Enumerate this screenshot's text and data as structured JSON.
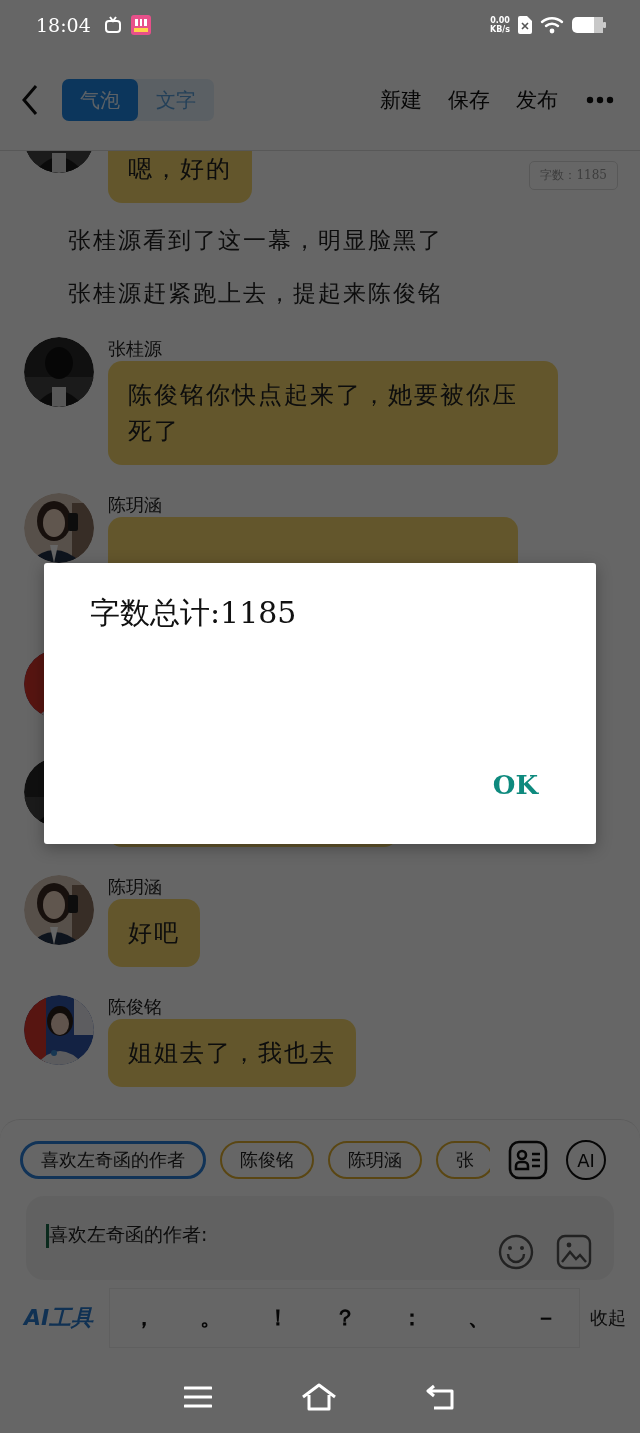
{
  "status_bar": {
    "time": "18:04",
    "net_speed": "0.00",
    "net_unit": "KB/s"
  },
  "header": {
    "tabs": [
      {
        "label": "气泡",
        "selected": true
      },
      {
        "label": "文字",
        "selected": false
      }
    ],
    "actions": [
      "新建",
      "保存",
      "发布"
    ]
  },
  "word_count_badge": "字数：1185",
  "messages": [
    {
      "kind": "bubble",
      "text": "嗯，好的"
    },
    {
      "kind": "narration",
      "text": "张桂源看到了这一幕，明显脸黑了"
    },
    {
      "kind": "narration",
      "text": "张桂源赶紧跑上去，提起来陈俊铭"
    },
    {
      "kind": "bubble",
      "name": "张桂源",
      "text": "陈俊铭你快点起来了，她要被你压死了"
    },
    {
      "kind": "partial",
      "name": "陈玥涵"
    },
    {
      "kind": "covered"
    },
    {
      "kind": "bubble"
    },
    {
      "kind": "bubble",
      "name": "陈玥涵",
      "text": "好吧"
    },
    {
      "kind": "bubble",
      "name": "陈俊铭",
      "text": "姐姐去了，我也去"
    }
  ],
  "chips": [
    {
      "label": "喜欢左奇函的作者",
      "selected": true
    },
    {
      "label": "陈俊铭",
      "selected": false
    },
    {
      "label": "陈玥涵",
      "selected": false
    },
    {
      "label": "张",
      "selected": false
    }
  ],
  "ai_button": "AI",
  "composer": {
    "value": "喜欢左奇函的作者:"
  },
  "toolbar": {
    "ai_tools": "AI工具",
    "punctuation": [
      "，",
      "。",
      "！",
      "？",
      "：",
      "、",
      "－"
    ],
    "collapse": "收起"
  },
  "dialog": {
    "message": "字数总计:1185",
    "button": "OK"
  }
}
